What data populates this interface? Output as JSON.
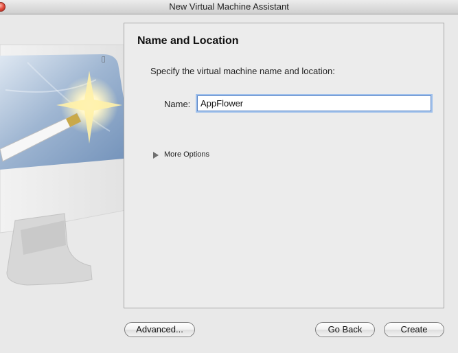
{
  "window": {
    "title": "New Virtual Machine Assistant"
  },
  "panel": {
    "heading": "Name and Location",
    "instruction": "Specify the virtual machine name and location:",
    "name_label": "Name:",
    "name_value": "AppFlower",
    "more_options_label": "More Options"
  },
  "buttons": {
    "advanced": "Advanced...",
    "go_back": "Go Back",
    "create": "Create"
  },
  "icons": {
    "close": "close-icon",
    "disclosure": "disclosure-triangle-icon",
    "illustration": "monitor-wand-illustration"
  }
}
